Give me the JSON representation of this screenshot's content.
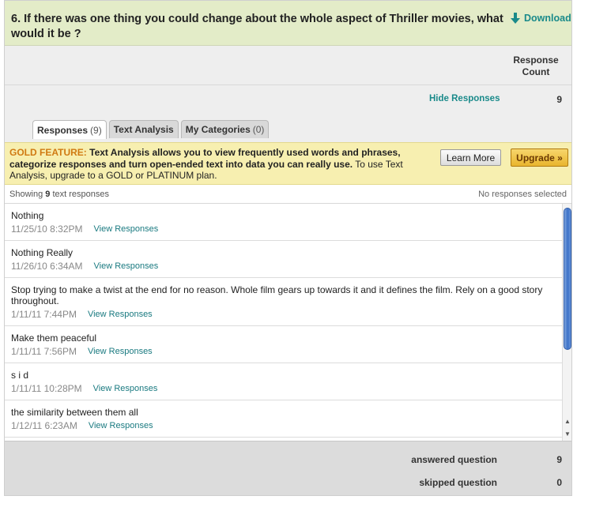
{
  "question": {
    "title": "6. If there was one thing you could change about the whole aspect of Thriller movies, what would it be ?",
    "download_label": "Download"
  },
  "summary": {
    "response_count_label": "Response Count",
    "hide_responses_label": "Hide Responses",
    "count": "9"
  },
  "tabs": [
    {
      "label": "Responses",
      "count": "(9)"
    },
    {
      "label": "Text Analysis",
      "count": ""
    },
    {
      "label": "My Categories",
      "count": "(0)"
    }
  ],
  "gold": {
    "label": "GOLD FEATURE:",
    "bold_text": "Text Analysis allows you to view frequently used words and phrases, categorize responses and turn open-ended text into data you can really use.",
    "plain_text": "To use Text Analysis, upgrade to a GOLD or PLATINUM plan.",
    "learn_more": "Learn More",
    "upgrade": "Upgrade »"
  },
  "showing": {
    "prefix": "Showing",
    "count": "9",
    "suffix": "text responses",
    "selection": "No responses selected"
  },
  "responses": [
    {
      "text": "Nothing",
      "date": "11/25/10 8:32PM",
      "link": "View Responses"
    },
    {
      "text": "Nothing Really",
      "date": "11/26/10 6:34AM",
      "link": "View Responses"
    },
    {
      "text": "Stop trying to make a twist at the end for no reason. Whole film gears up towards it and it defines the film. Rely on a good story throughout.",
      "date": "1/11/11 7:44PM",
      "link": "View Responses"
    },
    {
      "text": "Make them peaceful",
      "date": "1/11/11 7:56PM",
      "link": "View Responses"
    },
    {
      "text": "s i d",
      "date": "1/11/11 10:28PM",
      "link": "View Responses"
    },
    {
      "text": "the similarity between them all",
      "date": "1/12/11 6:23AM",
      "link": "View Responses"
    }
  ],
  "footer": {
    "answered_label": "answered question",
    "answered_value": "9",
    "skipped_label": "skipped question",
    "skipped_value": "0"
  },
  "colors": {
    "header_bg": "#e3ecc8",
    "gold_bg": "#f7efb0",
    "link": "#1a8a8a",
    "accent_orange": "#d07a12"
  }
}
